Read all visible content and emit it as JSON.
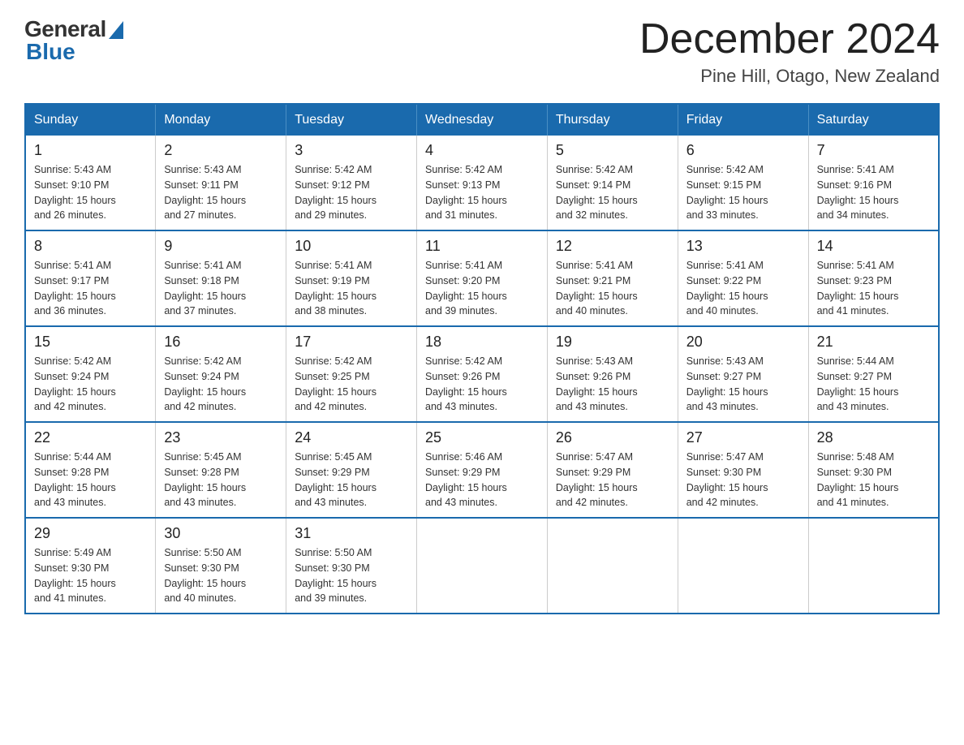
{
  "logo": {
    "general": "General",
    "blue": "Blue"
  },
  "title": "December 2024",
  "subtitle": "Pine Hill, Otago, New Zealand",
  "days_of_week": [
    "Sunday",
    "Monday",
    "Tuesday",
    "Wednesday",
    "Thursday",
    "Friday",
    "Saturday"
  ],
  "weeks": [
    [
      {
        "day": "1",
        "sunrise": "5:43 AM",
        "sunset": "9:10 PM",
        "daylight": "15 hours and 26 minutes."
      },
      {
        "day": "2",
        "sunrise": "5:43 AM",
        "sunset": "9:11 PM",
        "daylight": "15 hours and 27 minutes."
      },
      {
        "day": "3",
        "sunrise": "5:42 AM",
        "sunset": "9:12 PM",
        "daylight": "15 hours and 29 minutes."
      },
      {
        "day": "4",
        "sunrise": "5:42 AM",
        "sunset": "9:13 PM",
        "daylight": "15 hours and 31 minutes."
      },
      {
        "day": "5",
        "sunrise": "5:42 AM",
        "sunset": "9:14 PM",
        "daylight": "15 hours and 32 minutes."
      },
      {
        "day": "6",
        "sunrise": "5:42 AM",
        "sunset": "9:15 PM",
        "daylight": "15 hours and 33 minutes."
      },
      {
        "day": "7",
        "sunrise": "5:41 AM",
        "sunset": "9:16 PM",
        "daylight": "15 hours and 34 minutes."
      }
    ],
    [
      {
        "day": "8",
        "sunrise": "5:41 AM",
        "sunset": "9:17 PM",
        "daylight": "15 hours and 36 minutes."
      },
      {
        "day": "9",
        "sunrise": "5:41 AM",
        "sunset": "9:18 PM",
        "daylight": "15 hours and 37 minutes."
      },
      {
        "day": "10",
        "sunrise": "5:41 AM",
        "sunset": "9:19 PM",
        "daylight": "15 hours and 38 minutes."
      },
      {
        "day": "11",
        "sunrise": "5:41 AM",
        "sunset": "9:20 PM",
        "daylight": "15 hours and 39 minutes."
      },
      {
        "day": "12",
        "sunrise": "5:41 AM",
        "sunset": "9:21 PM",
        "daylight": "15 hours and 40 minutes."
      },
      {
        "day": "13",
        "sunrise": "5:41 AM",
        "sunset": "9:22 PM",
        "daylight": "15 hours and 40 minutes."
      },
      {
        "day": "14",
        "sunrise": "5:41 AM",
        "sunset": "9:23 PM",
        "daylight": "15 hours and 41 minutes."
      }
    ],
    [
      {
        "day": "15",
        "sunrise": "5:42 AM",
        "sunset": "9:24 PM",
        "daylight": "15 hours and 42 minutes."
      },
      {
        "day": "16",
        "sunrise": "5:42 AM",
        "sunset": "9:24 PM",
        "daylight": "15 hours and 42 minutes."
      },
      {
        "day": "17",
        "sunrise": "5:42 AM",
        "sunset": "9:25 PM",
        "daylight": "15 hours and 42 minutes."
      },
      {
        "day": "18",
        "sunrise": "5:42 AM",
        "sunset": "9:26 PM",
        "daylight": "15 hours and 43 minutes."
      },
      {
        "day": "19",
        "sunrise": "5:43 AM",
        "sunset": "9:26 PM",
        "daylight": "15 hours and 43 minutes."
      },
      {
        "day": "20",
        "sunrise": "5:43 AM",
        "sunset": "9:27 PM",
        "daylight": "15 hours and 43 minutes."
      },
      {
        "day": "21",
        "sunrise": "5:44 AM",
        "sunset": "9:27 PM",
        "daylight": "15 hours and 43 minutes."
      }
    ],
    [
      {
        "day": "22",
        "sunrise": "5:44 AM",
        "sunset": "9:28 PM",
        "daylight": "15 hours and 43 minutes."
      },
      {
        "day": "23",
        "sunrise": "5:45 AM",
        "sunset": "9:28 PM",
        "daylight": "15 hours and 43 minutes."
      },
      {
        "day": "24",
        "sunrise": "5:45 AM",
        "sunset": "9:29 PM",
        "daylight": "15 hours and 43 minutes."
      },
      {
        "day": "25",
        "sunrise": "5:46 AM",
        "sunset": "9:29 PM",
        "daylight": "15 hours and 43 minutes."
      },
      {
        "day": "26",
        "sunrise": "5:47 AM",
        "sunset": "9:29 PM",
        "daylight": "15 hours and 42 minutes."
      },
      {
        "day": "27",
        "sunrise": "5:47 AM",
        "sunset": "9:30 PM",
        "daylight": "15 hours and 42 minutes."
      },
      {
        "day": "28",
        "sunrise": "5:48 AM",
        "sunset": "9:30 PM",
        "daylight": "15 hours and 41 minutes."
      }
    ],
    [
      {
        "day": "29",
        "sunrise": "5:49 AM",
        "sunset": "9:30 PM",
        "daylight": "15 hours and 41 minutes."
      },
      {
        "day": "30",
        "sunrise": "5:50 AM",
        "sunset": "9:30 PM",
        "daylight": "15 hours and 40 minutes."
      },
      {
        "day": "31",
        "sunrise": "5:50 AM",
        "sunset": "9:30 PM",
        "daylight": "15 hours and 39 minutes."
      },
      null,
      null,
      null,
      null
    ]
  ]
}
